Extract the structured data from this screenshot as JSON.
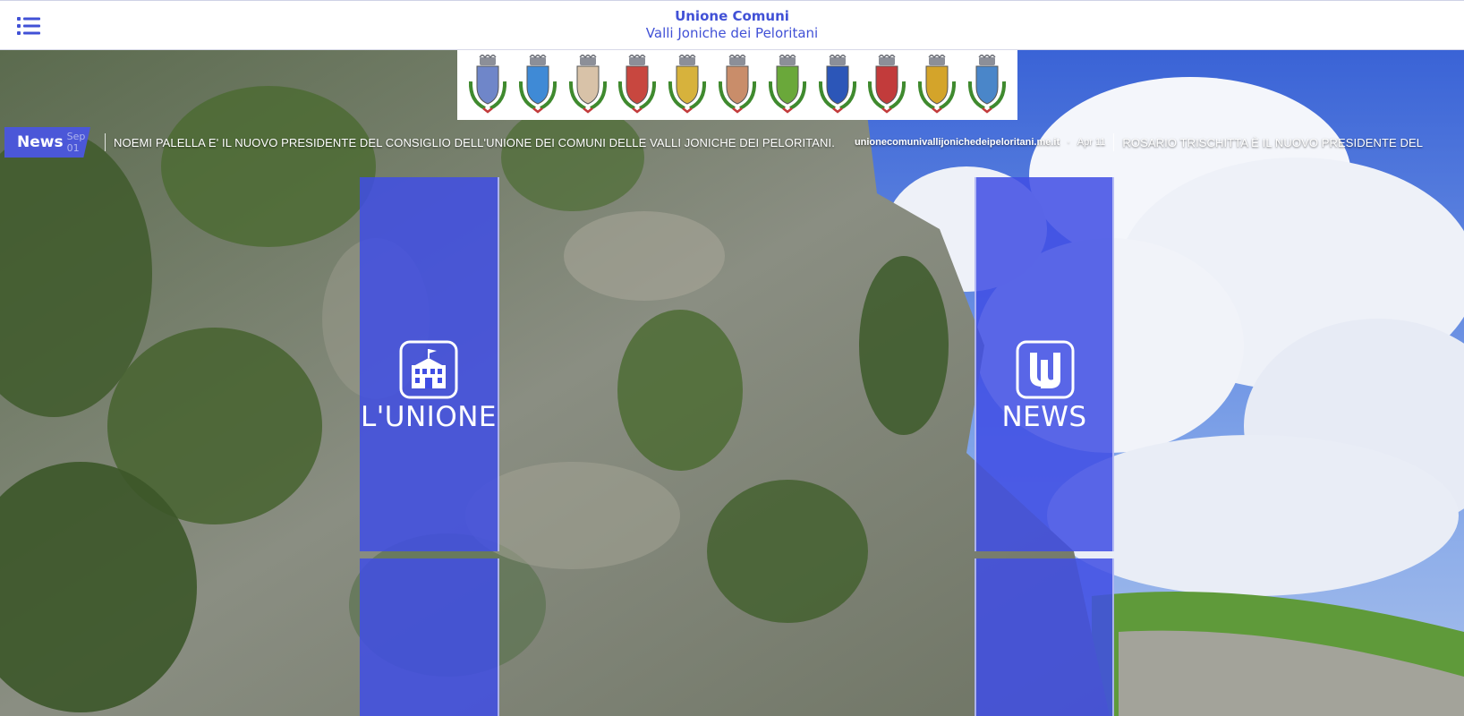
{
  "header": {
    "menu_icon": "list-icon",
    "title_line1": "Unione Comuni",
    "title_line2": "Valli Joniche dei Peloritani",
    "brand_color": "#4151d6"
  },
  "crests": [
    {
      "icon": "crest-icon",
      "color": "#6f86c9"
    },
    {
      "icon": "crest-icon",
      "color": "#3f8ad6"
    },
    {
      "icon": "crest-icon",
      "color": "#d8c2a8"
    },
    {
      "icon": "crest-icon",
      "color": "#c8473f"
    },
    {
      "icon": "crest-icon",
      "color": "#d7b23c"
    },
    {
      "icon": "crest-icon",
      "color": "#c98d6a"
    },
    {
      "icon": "crest-icon",
      "color": "#6aa83a"
    },
    {
      "icon": "crest-icon",
      "color": "#2c56b8"
    },
    {
      "icon": "crest-icon",
      "color": "#c23b3b"
    },
    {
      "icon": "crest-icon",
      "color": "#d4a42a"
    },
    {
      "icon": "crest-icon",
      "color": "#4a86c9"
    }
  ],
  "ticker": {
    "label": "News",
    "label_fragment": "Sep 01",
    "items": [
      {
        "title": "NOEMI PALELLA E' IL NUOVO PRESIDENTE DEL CONSIGLIO DELL'UNIONE DEI COMUNI DELLE VALLI JONICHE DEI PELORITANI.",
        "source": "unionecomunivallijonichedeipeloritani.me.it",
        "date": "Apr 11"
      },
      {
        "title": "ROSARIO TRISCHITTA È IL NUOVO PRESIDENTE DEL",
        "source": "",
        "date": ""
      }
    ]
  },
  "tiles": [
    {
      "label": "L'UNIONE",
      "icon": "town-hall-icon"
    },
    {
      "label": "NEWS",
      "icon": "news-logo-icon"
    }
  ],
  "accent": "#4b57d8"
}
